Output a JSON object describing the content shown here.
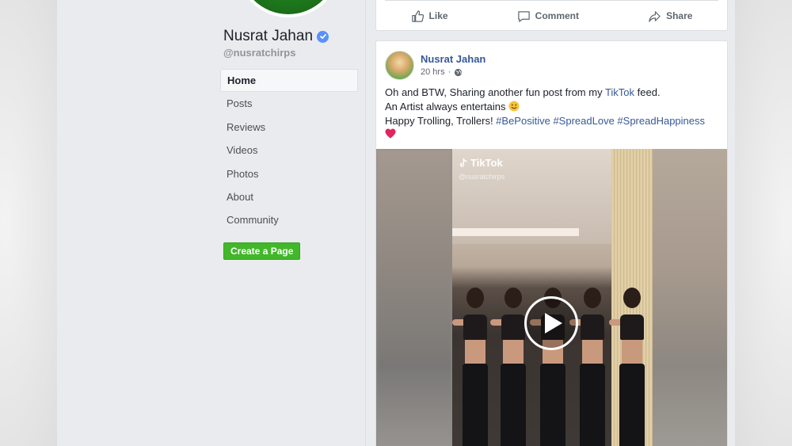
{
  "page": {
    "name": "Nusrat Jahan",
    "handle": "@nusratchirps"
  },
  "nav": {
    "items": [
      {
        "label": "Home",
        "active": true
      },
      {
        "label": "Posts"
      },
      {
        "label": "Reviews"
      },
      {
        "label": "Videos"
      },
      {
        "label": "Photos"
      },
      {
        "label": "About"
      },
      {
        "label": "Community"
      }
    ],
    "create_page_label": "Create a Page"
  },
  "prev_post_actions": {
    "like": "Like",
    "comment": "Comment",
    "share": "Share"
  },
  "post": {
    "author": "Nusrat Jahan",
    "time": "20 hrs",
    "time_sep": "·",
    "line1_a": "Oh and BTW, Sharing another fun post from my ",
    "line1_link": "TikTok",
    "line1_b": " feed.",
    "line2": "An Artist always entertains ",
    "line3_a": "Happy Trolling, Trollers! ",
    "hashtags": [
      "#BePositive",
      "#SpreadLove",
      "#SpreadHappiness"
    ],
    "video": {
      "brand": "TikTok",
      "handle": "@nusratchirps"
    }
  },
  "colors": {
    "link": "#385898",
    "create_button": "#42b72a",
    "verified": "#5890ff",
    "heart": "#e0245e"
  }
}
